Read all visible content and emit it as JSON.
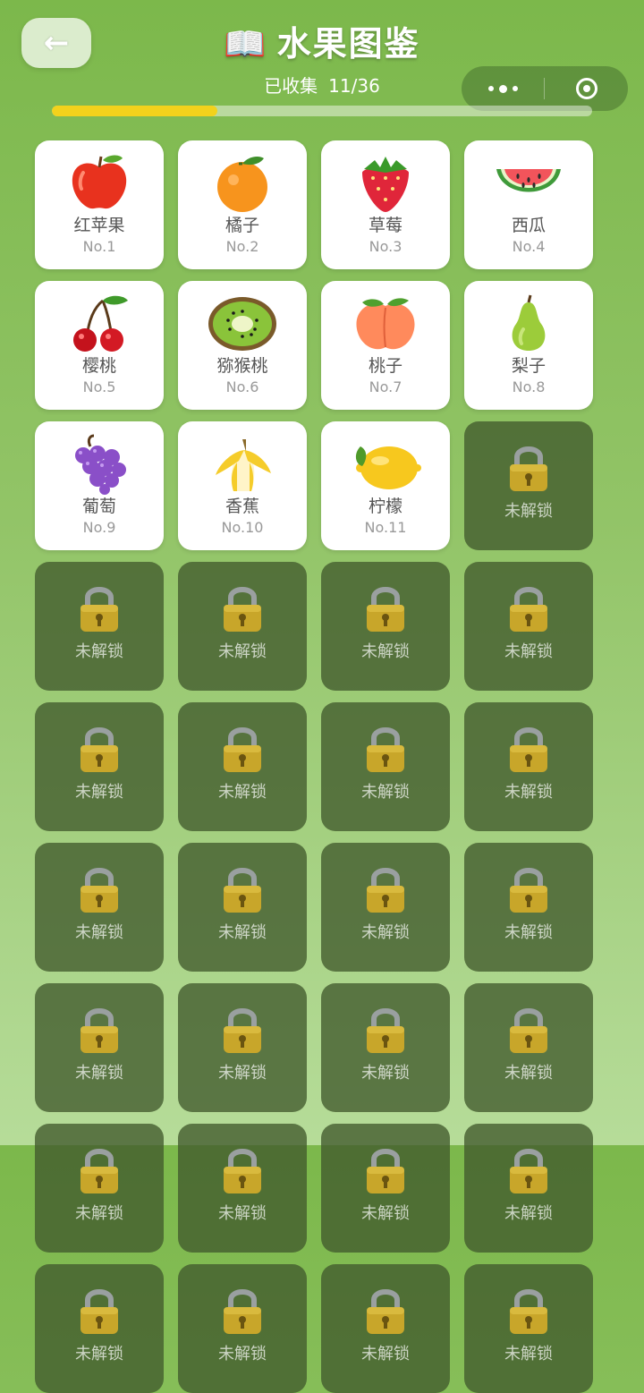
{
  "header": {
    "back_label": "←",
    "title": "水果图鉴",
    "title_icon": "📖",
    "progress_label": "已收集",
    "progress_count": "11/36",
    "progress_fraction": 0.306
  },
  "colors": {
    "progress_fill": "#f2d21c",
    "background_top": "#7cb84b",
    "background_bottom": "#b6dc99",
    "locked_card": "#415a2d"
  },
  "fruits": [
    {
      "name": "红苹果",
      "no": "No.1",
      "icon": "apple-icon"
    },
    {
      "name": "橘子",
      "no": "No.2",
      "icon": "orange-icon"
    },
    {
      "name": "草莓",
      "no": "No.3",
      "icon": "strawberry-icon"
    },
    {
      "name": "西瓜",
      "no": "No.4",
      "icon": "watermelon-icon"
    },
    {
      "name": "樱桃",
      "no": "No.5",
      "icon": "cherry-icon"
    },
    {
      "name": "猕猴桃",
      "no": "No.6",
      "icon": "kiwi-icon"
    },
    {
      "name": "桃子",
      "no": "No.7",
      "icon": "peach-icon"
    },
    {
      "name": "梨子",
      "no": "No.8",
      "icon": "pear-icon"
    },
    {
      "name": "葡萄",
      "no": "No.9",
      "icon": "grapes-icon"
    },
    {
      "name": "香蕉",
      "no": "No.10",
      "icon": "banana-icon"
    },
    {
      "name": "柠檬",
      "no": "No.11",
      "icon": "lemon-icon"
    }
  ],
  "locked_label": "未解锁",
  "locked_count": 25
}
